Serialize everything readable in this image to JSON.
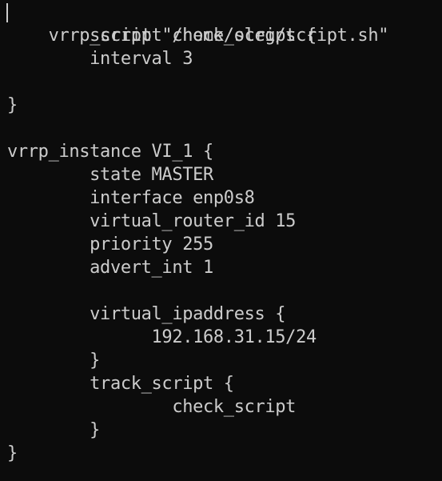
{
  "terminal": {
    "lines": [
      "vrrp_script check_script {",
      "        script \"/home/oleg/script.sh\"",
      "        interval 3",
      "",
      "}",
      "",
      "vrrp_instance VI_1 {",
      "        state MASTER",
      "        interface enp0s8",
      "        virtual_router_id 15",
      "        priority 255",
      "        advert_int 1",
      "",
      "        virtual_ipaddress {",
      "              192.168.31.15/24",
      "        }",
      "        track_script {",
      "                check_script",
      "        }",
      "}"
    ]
  }
}
